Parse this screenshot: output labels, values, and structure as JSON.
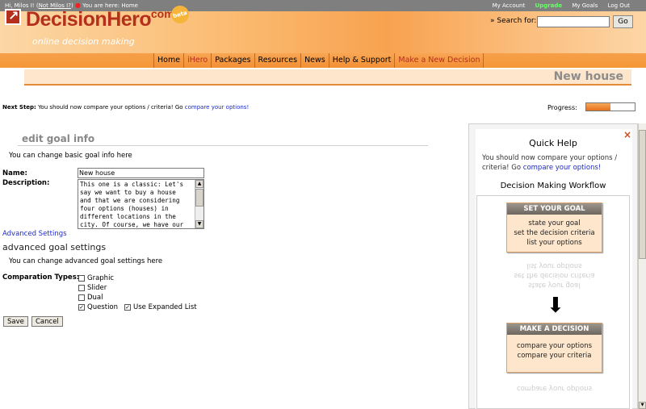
{
  "topbar": {
    "greeting": "Hi, Milos I! (",
    "not_user": "Not Milos I?",
    "greeting_end": ")",
    "location": "You are here: Home",
    "links": [
      "My Account",
      "Upgrade",
      "My Goals",
      "Log Out"
    ]
  },
  "header": {
    "logo_text": "DecisionHero",
    "logo_com": ".com",
    "logo_beta": "beta",
    "tagline": "online decision making",
    "search_label": "» Search for:",
    "search_value": "",
    "search_button": "Go"
  },
  "nav": {
    "items": [
      "Home",
      "iHero",
      "Packages",
      "Resources",
      "News",
      "Help & Support",
      "Make a New Decision"
    ]
  },
  "page": {
    "title": "New house",
    "next_step_label": "Next Step:",
    "next_step_text": " You should now compare your options / criteria! Go ",
    "next_step_link": "compare your options!",
    "progress_label": "Progress:",
    "progress_value": 0.5
  },
  "form": {
    "section_title": "edit goal info",
    "section_help": "You can change basic goal info here",
    "name_label": "Name:",
    "name_value": "New house",
    "description_label": "Description:",
    "description_value": "This one is a classic: Let's\nsay we want to buy a house\nand that we are considering\nfour options (houses) in\ndifferent locations in the\ncity. Of course, we have our",
    "advanced_link": "Advanced Settings",
    "advanced_title": "advanced goal settings",
    "advanced_help": "You can change advanced goal settings here",
    "comparation_label": "Comparation Types:",
    "options": [
      {
        "label": "Graphic",
        "checked": false
      },
      {
        "label": "Slider",
        "checked": false
      },
      {
        "label": "Dual",
        "checked": false
      },
      {
        "label": "Question",
        "checked": true
      }
    ],
    "expanded_label": "Use Expanded List",
    "expanded_checked": true,
    "save_label": "Save",
    "cancel_label": "Cancel"
  },
  "quickhelp": {
    "close": "×",
    "title": "Quick Help",
    "text": "You should now compare your options / criteria! Go ",
    "link": "compare your options!",
    "workflow_title": "Decision Making Workflow",
    "card1": {
      "head": "SET YOUR GOAL",
      "lines": [
        "state your goal",
        "set the decision criteria",
        "list your options"
      ]
    },
    "card2": {
      "head": "MAKE A DECISION",
      "lines": [
        "compare your options",
        "compare your criteria"
      ]
    }
  }
}
